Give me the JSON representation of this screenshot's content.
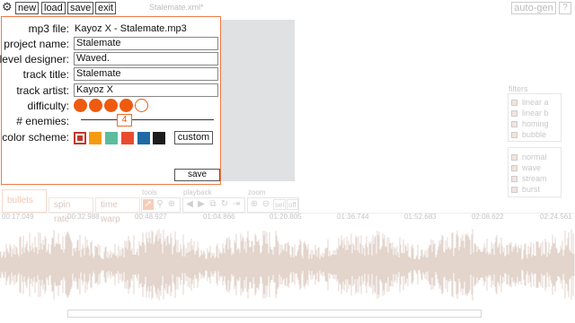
{
  "topbar": {
    "new_label": "new",
    "load_label": "load",
    "save_label": "save",
    "exit_label": "exit",
    "filename": "Stalemate.xml*",
    "autogen_label": "auto-gen",
    "help_label": "?"
  },
  "icons": {
    "gear": "gear-icon"
  },
  "filters": {
    "title": "filters",
    "items": [
      "linear a",
      "linear b",
      "homing",
      "bubble"
    ]
  },
  "patterns": {
    "items": [
      "normal",
      "wave",
      "stream",
      "burst"
    ]
  },
  "tabs": {
    "bullets": "bullets",
    "spin_rate": "spin rate",
    "time_warp": "time warp"
  },
  "toolbars": {
    "tools_label": "tools",
    "playback_label": "playback",
    "zoom_label": "zoom",
    "zoom_sel": "sel",
    "zoom_off": "off"
  },
  "timeline": {
    "ticks": [
      "00:17.049",
      "00:32.988",
      "00:48.927",
      "01:04.866",
      "01:20.805",
      "01:36.744",
      "01:52.683",
      "02:08.622",
      "02:24.561"
    ]
  },
  "dialog": {
    "mp3_label": "mp3 file:",
    "mp3_value": "Kayoz X - Stalemate.mp3",
    "project_label": "project name:",
    "project_value": "Stalemate",
    "designer_label": "level designer:",
    "designer_value": "Waved.",
    "title_label": "track title:",
    "title_value": "Stalemate",
    "artist_label": "track artist:",
    "artist_value": "Kayoz X",
    "difficulty_label": "difficulty:",
    "difficulty_level": 4,
    "difficulty_max": 5,
    "enemies_label": "# enemies:",
    "enemies_value": "4",
    "color_label": "color scheme:",
    "colors": [
      "#c0392b",
      "#f39c12",
      "#5dbb9e",
      "#e84c2e",
      "#1f6aa5",
      "#1c1c1c"
    ],
    "custom_label": "custom",
    "save_label": "save"
  }
}
